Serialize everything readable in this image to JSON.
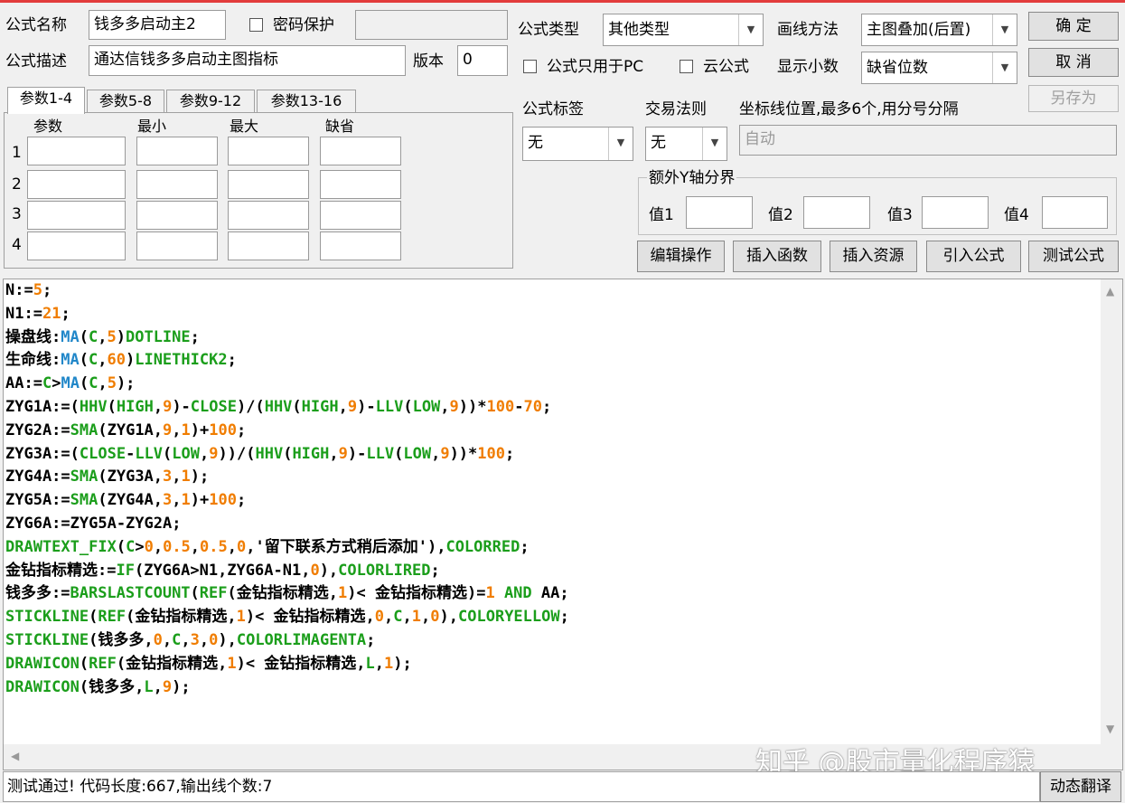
{
  "formula": {
    "name_label": "公式名称",
    "name_value": "钱多多启动主2",
    "password_label": "密码保护",
    "password_value": "",
    "desc_label": "公式描述",
    "desc_value": "通达信钱多多启动主图指标",
    "version_label": "版本",
    "version_value": "0",
    "type_label": "公式类型",
    "type_value": "其他类型",
    "draw_label": "画线方法",
    "draw_value": "主图叠加(后置)",
    "pc_only_label": "公式只用于PC",
    "cloud_label": "云公式",
    "decimals_label": "显示小数",
    "decimals_value": "缺省位数",
    "tag_label": "公式标签",
    "tag_value": "无",
    "trade_label": "交易法则",
    "trade_value": "无",
    "axis_label": "坐标线位置,最多6个,用分号分隔",
    "axis_value": "自动",
    "extra_y_label": "额外Y轴分界",
    "y_values": [
      "值1",
      "值2",
      "值3",
      "值4"
    ]
  },
  "buttons": {
    "ok": "确  定",
    "cancel": "取  消",
    "save_as": "另存为",
    "edit_ops": "编辑操作",
    "insert_func": "插入函数",
    "insert_res": "插入资源",
    "import_formula": "引入公式",
    "test_formula": "测试公式",
    "dynamic_translate": "动态翻译"
  },
  "tabs": [
    "参数1-4",
    "参数5-8",
    "参数9-12",
    "参数13-16"
  ],
  "param_headers": [
    "参数",
    "最小",
    "最大",
    "缺省"
  ],
  "param_rows": [
    "1",
    "2",
    "3",
    "4"
  ],
  "status_text": "测试通过! 代码长度:667,输出线个数:7",
  "watermark": "知乎 @股市量化程序猿_",
  "colors": {
    "keyword": "#1b9e1b",
    "function": "#2187c9",
    "number": "#f07d00",
    "accent_top": "#e23c3c"
  },
  "code_lines": [
    [
      [
        "k",
        "N:="
      ],
      [
        "o",
        "5"
      ],
      [
        "k",
        ";"
      ]
    ],
    [
      [
        "k",
        "N1:="
      ],
      [
        "o",
        "21"
      ],
      [
        "k",
        ";"
      ]
    ],
    [
      [
        "k",
        "操盘线:"
      ],
      [
        "b",
        "MA"
      ],
      [
        "k",
        "("
      ],
      [
        "g",
        "C"
      ],
      [
        "k",
        ","
      ],
      [
        "o",
        "5"
      ],
      [
        "k",
        ")"
      ],
      [
        "g",
        "DOTLINE"
      ],
      [
        "k",
        ";"
      ]
    ],
    [
      [
        "k",
        "生命线:"
      ],
      [
        "b",
        "MA"
      ],
      [
        "k",
        "("
      ],
      [
        "g",
        "C"
      ],
      [
        "k",
        ","
      ],
      [
        "o",
        "60"
      ],
      [
        "k",
        ")"
      ],
      [
        "g",
        "LINETHICK2"
      ],
      [
        "k",
        ";"
      ]
    ],
    [
      [
        "k",
        "AA:="
      ],
      [
        "g",
        "C"
      ],
      [
        "k",
        ">"
      ],
      [
        "b",
        "MA"
      ],
      [
        "k",
        "("
      ],
      [
        "g",
        "C"
      ],
      [
        "k",
        ","
      ],
      [
        "o",
        "5"
      ],
      [
        "k",
        ");"
      ]
    ],
    [
      [
        "k",
        "ZYG1A:=("
      ],
      [
        "g",
        "HHV"
      ],
      [
        "k",
        "("
      ],
      [
        "g",
        "HIGH"
      ],
      [
        "k",
        ","
      ],
      [
        "o",
        "9"
      ],
      [
        "k",
        ")-"
      ],
      [
        "g",
        "CLOSE"
      ],
      [
        "k",
        ")/("
      ],
      [
        "g",
        "HHV"
      ],
      [
        "k",
        "("
      ],
      [
        "g",
        "HIGH"
      ],
      [
        "k",
        ","
      ],
      [
        "o",
        "9"
      ],
      [
        "k",
        ")-"
      ],
      [
        "g",
        "LLV"
      ],
      [
        "k",
        "("
      ],
      [
        "g",
        "LOW"
      ],
      [
        "k",
        ","
      ],
      [
        "o",
        "9"
      ],
      [
        "k",
        "))*"
      ],
      [
        "o",
        "100"
      ],
      [
        "k",
        "-"
      ],
      [
        "o",
        "70"
      ],
      [
        "k",
        ";"
      ]
    ],
    [
      [
        "k",
        "ZYG2A:="
      ],
      [
        "g",
        "SMA"
      ],
      [
        "k",
        "(ZYG1A,"
      ],
      [
        "o",
        "9"
      ],
      [
        "k",
        ","
      ],
      [
        "o",
        "1"
      ],
      [
        "k",
        ")+"
      ],
      [
        "o",
        "100"
      ],
      [
        "k",
        ";"
      ]
    ],
    [
      [
        "k",
        "ZYG3A:=("
      ],
      [
        "g",
        "CLOSE"
      ],
      [
        "k",
        "-"
      ],
      [
        "g",
        "LLV"
      ],
      [
        "k",
        "("
      ],
      [
        "g",
        "LOW"
      ],
      [
        "k",
        ","
      ],
      [
        "o",
        "9"
      ],
      [
        "k",
        "))/("
      ],
      [
        "g",
        "HHV"
      ],
      [
        "k",
        "("
      ],
      [
        "g",
        "HIGH"
      ],
      [
        "k",
        ","
      ],
      [
        "o",
        "9"
      ],
      [
        "k",
        ")-"
      ],
      [
        "g",
        "LLV"
      ],
      [
        "k",
        "("
      ],
      [
        "g",
        "LOW"
      ],
      [
        "k",
        ","
      ],
      [
        "o",
        "9"
      ],
      [
        "k",
        "))*"
      ],
      [
        "o",
        "100"
      ],
      [
        "k",
        ";"
      ]
    ],
    [
      [
        "k",
        "ZYG4A:="
      ],
      [
        "g",
        "SMA"
      ],
      [
        "k",
        "(ZYG3A,"
      ],
      [
        "o",
        "3"
      ],
      [
        "k",
        ","
      ],
      [
        "o",
        "1"
      ],
      [
        "k",
        ");"
      ]
    ],
    [
      [
        "k",
        "ZYG5A:="
      ],
      [
        "g",
        "SMA"
      ],
      [
        "k",
        "(ZYG4A,"
      ],
      [
        "o",
        "3"
      ],
      [
        "k",
        ","
      ],
      [
        "o",
        "1"
      ],
      [
        "k",
        ")+"
      ],
      [
        "o",
        "100"
      ],
      [
        "k",
        ";"
      ]
    ],
    [
      [
        "k",
        "ZYG6A:=ZYG5A-ZYG2A;"
      ]
    ],
    [
      [
        "g",
        "DRAWTEXT_FIX"
      ],
      [
        "k",
        "("
      ],
      [
        "g",
        "C"
      ],
      [
        "k",
        ">"
      ],
      [
        "o",
        "0"
      ],
      [
        "k",
        ","
      ],
      [
        "o",
        "0.5"
      ],
      [
        "k",
        ","
      ],
      [
        "o",
        "0.5"
      ],
      [
        "k",
        ","
      ],
      [
        "o",
        "0"
      ],
      [
        "k",
        ",'留下联系方式稍后添加'),"
      ],
      [
        "g",
        "COLORRED"
      ],
      [
        "k",
        ";"
      ]
    ],
    [
      [
        "k",
        "金钻指标精选:="
      ],
      [
        "g",
        "IF"
      ],
      [
        "k",
        "(ZYG6A>N1,ZYG6A-N1,"
      ],
      [
        "o",
        "0"
      ],
      [
        "k",
        "),"
      ],
      [
        "g",
        "COLORLIRED"
      ],
      [
        "k",
        ";"
      ]
    ],
    [
      [
        "k",
        "钱多多:="
      ],
      [
        "g",
        "BARSLASTCOUNT"
      ],
      [
        "k",
        "("
      ],
      [
        "g",
        "REF"
      ],
      [
        "k",
        "(金钻指标精选,"
      ],
      [
        "o",
        "1"
      ],
      [
        "k",
        ")< 金钻指标精选)="
      ],
      [
        "o",
        "1"
      ],
      [
        "k",
        " "
      ],
      [
        "g",
        "AND"
      ],
      [
        "k",
        " AA;"
      ]
    ],
    [
      [
        "g",
        "STICKLINE"
      ],
      [
        "k",
        "("
      ],
      [
        "g",
        "REF"
      ],
      [
        "k",
        "(金钻指标精选,"
      ],
      [
        "o",
        "1"
      ],
      [
        "k",
        ")< 金钻指标精选,"
      ],
      [
        "o",
        "0"
      ],
      [
        "k",
        ","
      ],
      [
        "g",
        "C"
      ],
      [
        "k",
        ","
      ],
      [
        "o",
        "1"
      ],
      [
        "k",
        ","
      ],
      [
        "o",
        "0"
      ],
      [
        "k",
        "),"
      ],
      [
        "g",
        "COLORYELLOW"
      ],
      [
        "k",
        ";"
      ]
    ],
    [
      [
        "g",
        "STICKLINE"
      ],
      [
        "k",
        "(钱多多,"
      ],
      [
        "o",
        "0"
      ],
      [
        "k",
        ","
      ],
      [
        "g",
        "C"
      ],
      [
        "k",
        ","
      ],
      [
        "o",
        "3"
      ],
      [
        "k",
        ","
      ],
      [
        "o",
        "0"
      ],
      [
        "k",
        "),"
      ],
      [
        "g",
        "COLORLIMAGENTA"
      ],
      [
        "k",
        ";"
      ]
    ],
    [
      [
        "g",
        "DRAWICON"
      ],
      [
        "k",
        "("
      ],
      [
        "g",
        "REF"
      ],
      [
        "k",
        "(金钻指标精选,"
      ],
      [
        "o",
        "1"
      ],
      [
        "k",
        ")< 金钻指标精选,"
      ],
      [
        "g",
        "L"
      ],
      [
        "k",
        ","
      ],
      [
        "o",
        "1"
      ],
      [
        "k",
        ");"
      ]
    ],
    [
      [
        "g",
        "DRAWICON"
      ],
      [
        "k",
        "(钱多多,"
      ],
      [
        "g",
        "L"
      ],
      [
        "k",
        ","
      ],
      [
        "o",
        "9"
      ],
      [
        "k",
        ");"
      ]
    ]
  ]
}
